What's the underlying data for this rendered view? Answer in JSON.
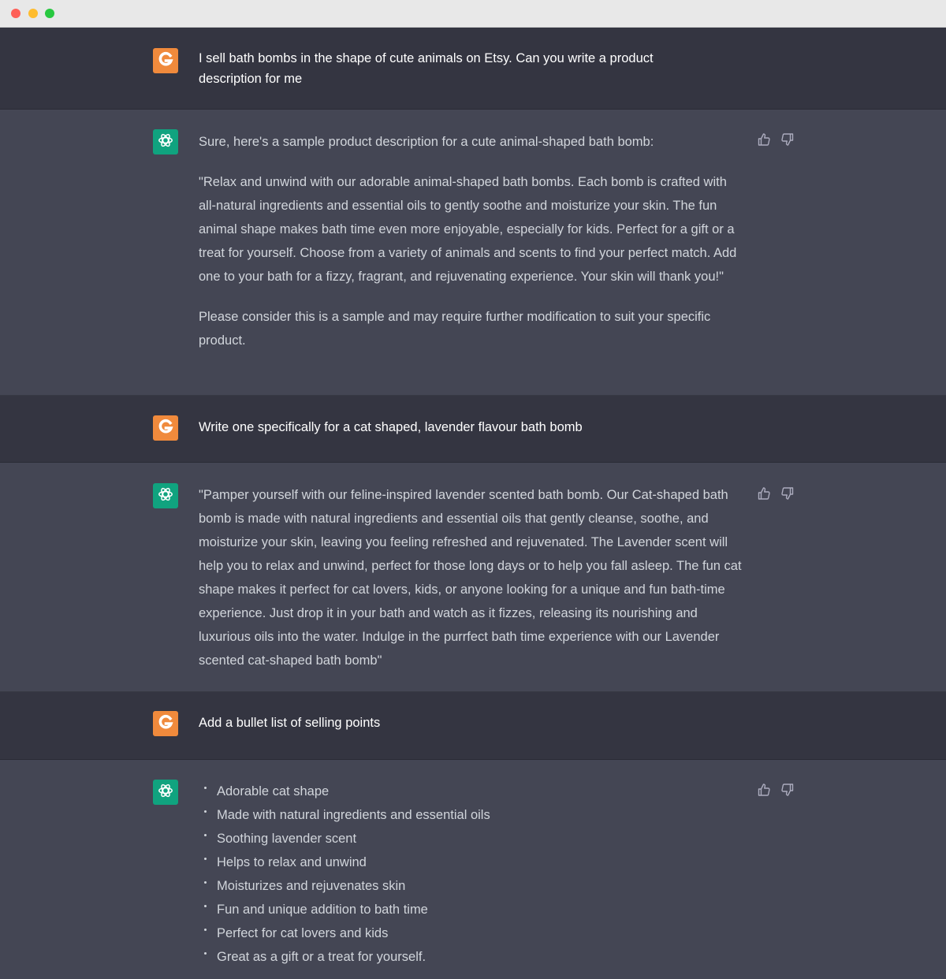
{
  "window": {
    "controls": [
      "close",
      "minimize",
      "maximize"
    ]
  },
  "colors": {
    "user_bg": "#343541",
    "assistant_bg": "#444654",
    "user_avatar": "#f08a3c",
    "assistant_avatar": "#10a37f"
  },
  "conversation": {
    "m1": {
      "role": "user",
      "text": "I sell bath bombs in the shape of cute animals on Etsy. Can you write a product description for me"
    },
    "m2": {
      "role": "assistant",
      "paragraphs": [
        "Sure, here's a sample product description for a cute animal-shaped bath bomb:",
        "\"Relax and unwind with our adorable animal-shaped bath bombs. Each bomb is crafted with all-natural ingredients and essential oils to gently soothe and moisturize your skin. The fun animal shape makes bath time even more enjoyable, especially for kids. Perfect for a gift or a treat for yourself. Choose from a variety of animals and scents to find your perfect match. Add one to your bath for a fizzy, fragrant, and rejuvenating experience. Your skin will thank you!\"",
        "Please consider this is a sample and may require further modification to suit your specific product."
      ]
    },
    "m3": {
      "role": "user",
      "text": "Write one specifically for a cat shaped, lavender flavour bath bomb"
    },
    "m4": {
      "role": "assistant",
      "paragraphs": [
        "\"Pamper yourself with our feline-inspired lavender scented bath bomb. Our Cat-shaped bath bomb is made with natural ingredients and essential oils that gently cleanse, soothe, and moisturize your skin, leaving you feeling refreshed and rejuvenated. The Lavender scent will help you to relax and unwind, perfect for those long days or to help you fall asleep. The fun cat shape makes it perfect for cat lovers, kids, or anyone looking for a unique and fun bath-time experience. Just drop it in your bath and watch as it fizzes, releasing its nourishing and luxurious oils into the water. Indulge in the purrfect bath time experience with our Lavender scented cat-shaped bath bomb\""
      ]
    },
    "m5": {
      "role": "user",
      "text": "Add a bullet list of selling points"
    },
    "m6": {
      "role": "assistant",
      "bullets": [
        "Adorable cat shape",
        "Made with natural ingredients and essential oils",
        "Soothing lavender scent",
        "Helps to relax and unwind",
        "Moisturizes and rejuvenates skin",
        "Fun and unique addition to bath time",
        "Perfect for cat lovers and kids",
        "Great as a gift or a treat for yourself."
      ]
    }
  },
  "icons": {
    "user_avatar": "g-logo-icon",
    "assistant_avatar": "openai-logo-icon",
    "like": "thumbs-up-icon",
    "dislike": "thumbs-down-icon"
  }
}
